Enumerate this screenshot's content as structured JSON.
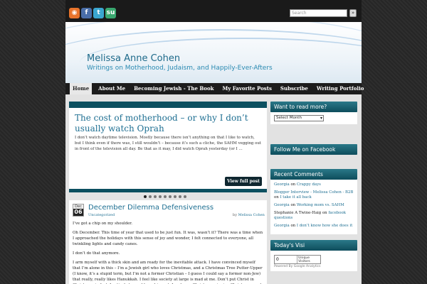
{
  "header": {
    "site_title": "Melissa Anne Cohen",
    "tagline": "Writings on Motherhood, Judaism, and Happily-Ever-Afters",
    "search_placeholder": "Search",
    "search_button": "»"
  },
  "social": {
    "rss": "rss-icon",
    "facebook": "f",
    "twitter": "t",
    "stumbleupon": "su"
  },
  "nav": {
    "items": [
      {
        "label": "Home"
      },
      {
        "label": "About Me"
      },
      {
        "label": "Becoming Jewish - The Book"
      },
      {
        "label": "My Favorite Posts"
      },
      {
        "label": "Subscribe"
      },
      {
        "label": "Writing Portfolio"
      }
    ]
  },
  "featured": {
    "title": "The cost of motherhood – or why I don’t usually watch Oprah",
    "excerpt": "I don’t watch daytime television. Mostly because there isn’t anything on that I like to watch, but I think even if there was, I still wouldn’t – because it’s such a cliche, the SAHM vegging out in front of the television all day. Be that as it may, I did watch Oprah yesterday (or I …",
    "button": "View full post"
  },
  "post": {
    "month": "Dec",
    "day": "06",
    "title": "December Dilemma Defensiveness",
    "category": "Uncategorized",
    "by": "by",
    "author": "Melissa Cohen",
    "paragraphs": [
      "I’ve got a chip on my shoulder.",
      "Oh December.  This time of year that used to be just fun.  It was, wasn’t it?  There was a time when I approached the holidays with this sense of joy and wonder, I felt connected to everyone, all twinkling lights and candy canes.",
      "I don’t do that anymore.",
      "I arm myself with a thick skin and am ready for the inevitable attack.  I have convinced myself that I’m alone in this – I’m a Jewish girl who loves Christmas, and a Christmas Tree Putter-Upper (I know, it’s a stupid term, but I’m not a former Christian – I guess I could say a former non-Jew) that really, really likes Hanukkah.  I feel like society at large is mad at me.  Don’t put Christ in Christmas, in fact, I actively try and keep him out.  I embrace Christmas, singing Christmas carols and buy too"
    ]
  },
  "sidebar": {
    "archive": {
      "title": "Want to read more?",
      "select_value": "Select Month"
    },
    "facebook": {
      "title": "Follow Me on Facebook"
    },
    "recent_comments": {
      "title": "Recent Comments",
      "items": [
        {
          "author": "Georgia",
          "on": "on",
          "post": "Crappy days"
        },
        {
          "author": "Blogger Interview - Melissa Cohen - B2B",
          "on": "on",
          "post": "I take it all back"
        },
        {
          "author": "Georgia",
          "on": "on",
          "post": "Working mom vs. SAHM"
        },
        {
          "author": "Stephanie A Twine-Haig",
          "on": "on",
          "post": "facebook questions"
        },
        {
          "author": "Georgia",
          "on": "on",
          "post": "I don’t know how she does it"
        }
      ]
    },
    "visits": {
      "title": "Today's Visi",
      "count": "0",
      "label": "Unique Visitors",
      "powered": "Powered By Google Analytics"
    }
  },
  "slider": {
    "dot_count": 9,
    "active_index": 0
  }
}
